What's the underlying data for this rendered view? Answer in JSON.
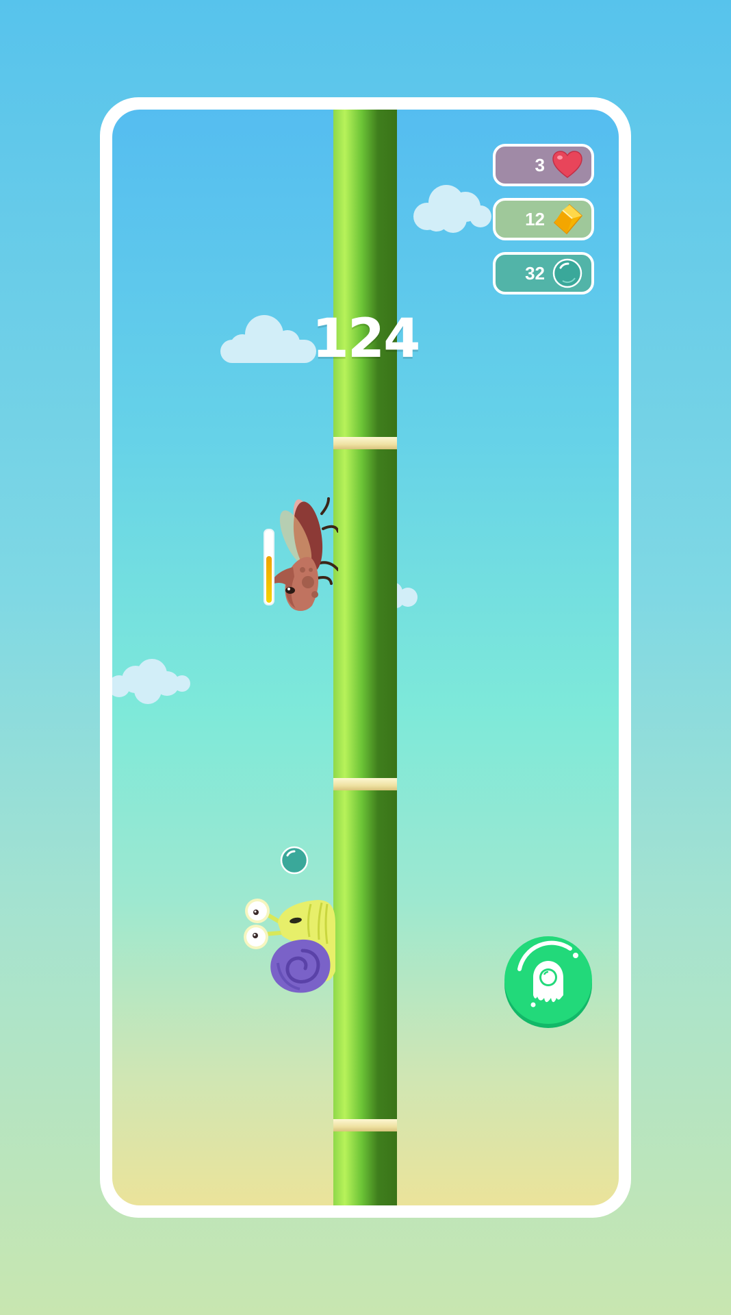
{
  "game": {
    "score": "124",
    "hud": {
      "lives": {
        "value": "3",
        "icon": "heart-icon"
      },
      "gems": {
        "value": "12",
        "icon": "gem-icon"
      },
      "bubbles": {
        "value": "32",
        "icon": "bubble-icon"
      }
    },
    "beetle_energy_fraction": 0.65,
    "action_button": {
      "icon": "slime-ghost-icon"
    },
    "colors": {
      "bamboo": "#6bc336",
      "heart": "#e8455a",
      "gem": "#f6b400",
      "bubble": "#3aa89a",
      "action": "#1fd07a"
    }
  }
}
